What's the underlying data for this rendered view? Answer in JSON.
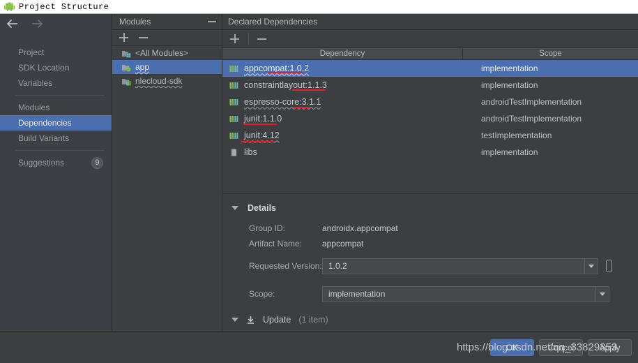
{
  "window": {
    "title": "Project Structure",
    "icon": "android-robot-icon"
  },
  "sidebar": {
    "nav": {
      "back": "back-arrow",
      "forward": "forward-arrow"
    },
    "group1": [
      {
        "label": "Project",
        "selected": false
      },
      {
        "label": "SDK Location",
        "selected": false
      },
      {
        "label": "Variables",
        "selected": false
      }
    ],
    "group2": [
      {
        "label": "Modules",
        "selected": false
      },
      {
        "label": "Dependencies",
        "selected": true
      },
      {
        "label": "Build Variants",
        "selected": false
      }
    ],
    "group3": [
      {
        "label": "Suggestions",
        "badge": "9",
        "selected": false
      }
    ]
  },
  "modules": {
    "title": "Modules",
    "collapse_icon": "minus-icon",
    "toolbar": {
      "add": "plus-icon",
      "remove": "minus-icon"
    },
    "items": [
      {
        "label": "<All Modules>",
        "icon": "all-modules-icon",
        "selected": false,
        "squiggle": false
      },
      {
        "label": "app",
        "icon": "android-module-icon",
        "selected": true,
        "squiggle": true
      },
      {
        "label": "nlecloud-sdk",
        "icon": "library-module-icon",
        "selected": false,
        "squiggle": true
      }
    ]
  },
  "dependencies": {
    "title": "Declared Dependencies",
    "toolbar": {
      "add": "plus-icon",
      "remove": "minus-icon"
    },
    "columns": {
      "dependency": "Dependency",
      "scope": "Scope"
    },
    "rows": [
      {
        "name": "appcompat:1.0.2",
        "scope": "implementation",
        "icon": "library-bars-icon",
        "selected": true,
        "squiggle": true,
        "annotated": true
      },
      {
        "name": "constraintlayout:1.1.3",
        "scope": "implementation",
        "icon": "library-bars-icon",
        "selected": false,
        "squiggle": false,
        "annotated": true
      },
      {
        "name": "espresso-core:3.1.1",
        "scope": "androidTestImplementation",
        "icon": "library-bars-icon",
        "selected": false,
        "squiggle": true,
        "annotated": true
      },
      {
        "name": "junit:1.1.0",
        "scope": "androidTestImplementation",
        "icon": "library-bars-icon",
        "selected": false,
        "squiggle": false,
        "annotated": true
      },
      {
        "name": "junit:4.12",
        "scope": "testImplementation",
        "icon": "library-bars-icon",
        "selected": false,
        "squiggle": true,
        "annotated": true
      },
      {
        "name": "libs",
        "scope": "implementation",
        "icon": "jar-file-icon",
        "selected": false,
        "squiggle": false,
        "annotated": false
      }
    ]
  },
  "details": {
    "title": "Details",
    "expand_icon": "triangle-down-icon",
    "group_id_label": "Group ID:",
    "group_id_value": "androidx.appcompat",
    "artifact_label": "Artifact Name:",
    "artifact_value": "appcompat",
    "version_label": "Requested Version:",
    "version_value": "1.0.2",
    "scope_label": "Scope:",
    "scope_value": "implementation",
    "variable_button": "insert-variable-icon"
  },
  "update": {
    "expand_icon": "triangle-down-icon",
    "download_icon": "download-icon",
    "label": "Update",
    "count": "(1 item)"
  },
  "buttons": {
    "ok": "OK",
    "cancel": "Cancel",
    "apply": "Apply"
  },
  "watermark": {
    "text": "https://blog.csdn.net/qq_33829353"
  },
  "colors": {
    "selection_blue": "#4b6eaf",
    "panel_bg": "#3c3f41",
    "sidebar_bg": "#3c4044",
    "annotation_red": "#ec1c24",
    "android_green": "#a4c639"
  }
}
